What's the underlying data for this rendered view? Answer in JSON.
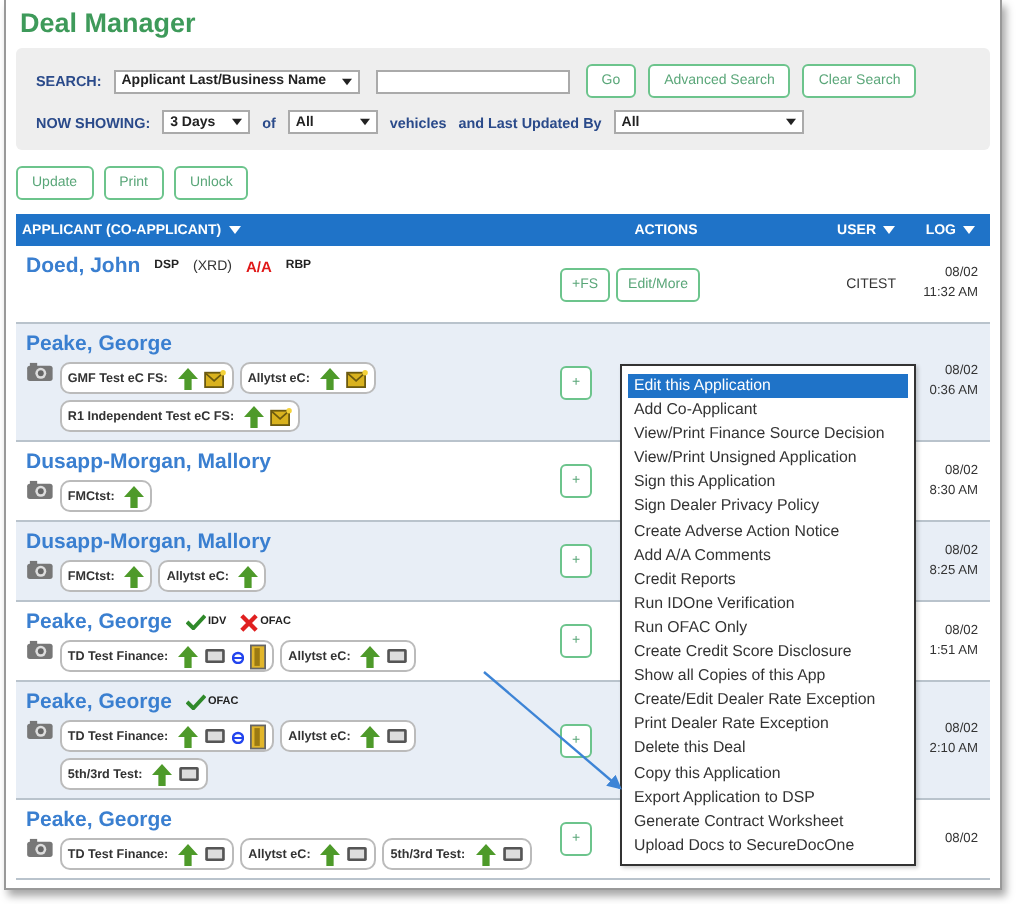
{
  "title": "Deal Manager",
  "search": {
    "label": "SEARCH:",
    "field": "Applicant Last/Business Name",
    "buttons": [
      "Go",
      "Advanced Search",
      "Clear Search"
    ]
  },
  "now_showing": {
    "label": "NOW SHOWING:",
    "period": "3 Days",
    "of": "of",
    "vehicles_filter": "All",
    "vehicles": "vehicles",
    "updated_by_label": "and Last Updated By",
    "updated_by": "All"
  },
  "toolbar": [
    "Update",
    "Print",
    "Unlock"
  ],
  "columns": [
    {
      "label": "APPLICANT (CO-APPLICANT)",
      "sortable": true
    },
    {
      "label": "ACTIONS",
      "sortable": false
    },
    {
      "label": "USER",
      "sortable": true
    },
    {
      "label": "LOG",
      "sortable": true
    }
  ],
  "rows": [
    {
      "name": "Doed, John",
      "camera": false,
      "tags": [
        {
          "kind": "plain",
          "label": "DSP"
        },
        {
          "kind": "paren",
          "label": "(XRD)"
        },
        {
          "kind": "alert",
          "label": "A/A"
        },
        {
          "kind": "plain",
          "label": "RBP"
        }
      ],
      "chips": [],
      "actions": [
        "+FS",
        "Edit/More"
      ],
      "user": "CITEST",
      "log": [
        "08/02",
        "11:32 AM"
      ]
    },
    {
      "name": "Peake, George",
      "camera": true,
      "tags": [],
      "chips": [
        {
          "label": "GMF Test eC FS:",
          "kind": "mail"
        },
        {
          "label": "Allytst eC:",
          "kind": "mail"
        },
        {
          "label": "R1 Independent Test eC FS:",
          "kind": "mail"
        }
      ],
      "actions": [
        "+"
      ],
      "log": [
        "08/02",
        "0:36 AM"
      ]
    },
    {
      "name": "Dusapp-Morgan, Mallory",
      "camera": true,
      "tags": [],
      "chips": [
        {
          "label": "FMCtst:",
          "kind": "plain"
        }
      ],
      "actions": [
        "+"
      ],
      "log": [
        "08/02",
        "8:30 AM"
      ]
    },
    {
      "name": "Dusapp-Morgan, Mallory",
      "camera": true,
      "tags": [],
      "chips": [
        {
          "label": "FMCtst:",
          "kind": "plain"
        },
        {
          "label": "Allytst eC:",
          "kind": "plain"
        }
      ],
      "actions": [
        "+"
      ],
      "log": [
        "08/02",
        "8:25 AM"
      ]
    },
    {
      "name": "Peake, George",
      "camera": true,
      "tags": [
        {
          "kind": "check",
          "label": "IDV"
        },
        {
          "kind": "cross",
          "label": "OFAC"
        }
      ],
      "chips": [
        {
          "label": "TD Test Finance:",
          "kind": "contract"
        },
        {
          "label": "Allytst eC:",
          "kind": "card"
        }
      ],
      "actions": [
        "+"
      ],
      "log": [
        "08/02",
        "1:51 AM"
      ]
    },
    {
      "name": "Peake, George",
      "camera": true,
      "tags": [
        {
          "kind": "check",
          "label": "OFAC"
        }
      ],
      "chips": [
        {
          "label": "TD Test Finance:",
          "kind": "contract"
        },
        {
          "label": "Allytst eC:",
          "kind": "card"
        },
        {
          "label": "5th/3rd Test:",
          "kind": "card"
        }
      ],
      "actions": [
        "+"
      ],
      "log": [
        "08/02",
        "2:10 AM"
      ]
    },
    {
      "name": "Peake, George",
      "camera": true,
      "tags": [],
      "chips": [
        {
          "label": "TD Test Finance:",
          "kind": "card"
        },
        {
          "label": "Allytst eC:",
          "kind": "card"
        },
        {
          "label": "5th/3rd Test:",
          "kind": "card"
        }
      ],
      "actions": [
        "+"
      ],
      "log": [
        "08/02"
      ]
    }
  ],
  "menu": {
    "items": [
      {
        "label": "Edit this Application",
        "selected": true
      },
      {
        "label": "Add Co-Applicant",
        "selected": false
      },
      {
        "label": "View/Print Finance Source Decision",
        "selected": false
      },
      {
        "label": "View/Print Unsigned Application",
        "selected": false
      },
      {
        "label": "Sign this Application",
        "selected": false
      },
      {
        "label": "Sign Dealer Privacy Policy",
        "selected": false
      },
      {
        "label": "Create Adverse Action Notice",
        "selected": false
      },
      {
        "label": "Add A/A Comments",
        "selected": false
      },
      {
        "label": "Credit Reports",
        "selected": false
      },
      {
        "label": "Run IDOne Verification",
        "selected": false
      },
      {
        "label": "Run OFAC Only",
        "selected": false
      },
      {
        "label": "Create Credit Score Disclosure",
        "selected": false
      },
      {
        "label": "Show all Copies of this App",
        "selected": false
      },
      {
        "label": "Create/Edit Dealer Rate Exception",
        "selected": false
      },
      {
        "label": "Print Dealer Rate Exception",
        "selected": false
      },
      {
        "label": "Delete this Deal",
        "selected": false
      },
      {
        "label": "Copy this Application",
        "selected": false
      },
      {
        "label": "Export Application to DSP",
        "selected": false
      },
      {
        "label": "Generate Contract Worksheet",
        "selected": false
      },
      {
        "label": "Upload Docs to SecureDocOne",
        "selected": false
      }
    ]
  }
}
